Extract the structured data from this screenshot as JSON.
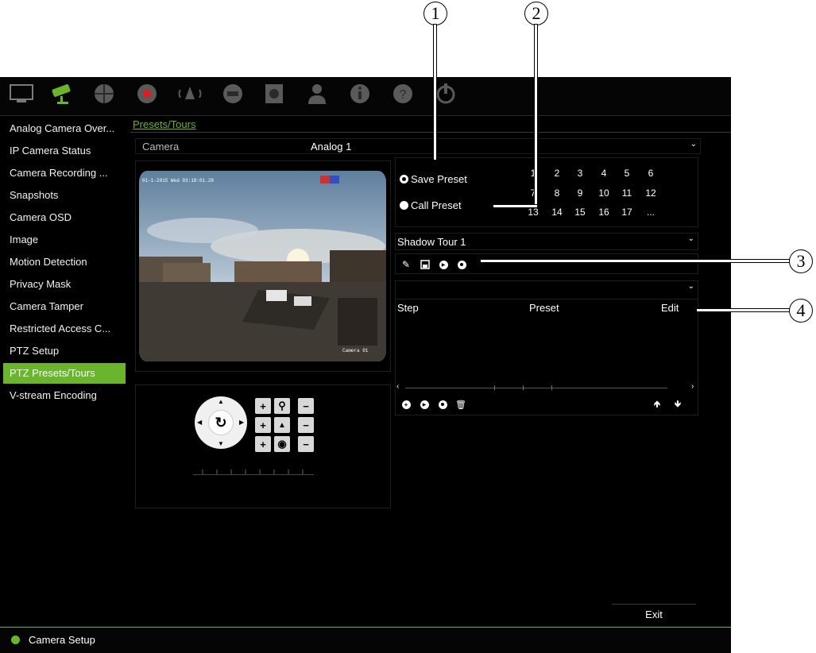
{
  "callouts": [
    "1",
    "2",
    "3",
    "4"
  ],
  "top_icons": [
    "monitor-icon",
    "camera-icon",
    "network-icon",
    "record-icon",
    "alarm-icon",
    "device-icon",
    "storage-icon",
    "user-icon",
    "system-icon",
    "help-icon",
    "power-icon"
  ],
  "sidebar": {
    "items": [
      {
        "label": "Analog Camera Over..."
      },
      {
        "label": "IP Camera Status"
      },
      {
        "label": "Camera Recording ..."
      },
      {
        "label": "Snapshots"
      },
      {
        "label": "Camera OSD"
      },
      {
        "label": "Image"
      },
      {
        "label": "Motion Detection"
      },
      {
        "label": "Privacy Mask"
      },
      {
        "label": "Camera Tamper"
      },
      {
        "label": "Restricted Access C..."
      },
      {
        "label": "PTZ Setup"
      },
      {
        "label": "PTZ Presets/Tours"
      },
      {
        "label": "V-stream Encoding"
      }
    ],
    "active_index": 11
  },
  "breadcrumb": "Presets/Tours",
  "camera": {
    "label": "Camera",
    "value": "Analog 1"
  },
  "video": {
    "timestamp": "01-1-2015 Wed 03:18:01.28",
    "osd_name": "Camera 01"
  },
  "presets": {
    "save_label": "Save Preset",
    "call_label": "Call Preset",
    "numbers": [
      "1",
      "2",
      "3",
      "4",
      "5",
      "6",
      "7",
      "8",
      "9",
      "10",
      "11",
      "12",
      "13",
      "14",
      "15",
      "16",
      "17",
      "..."
    ]
  },
  "tour": {
    "selected": "Shadow Tour 1"
  },
  "table": {
    "headers": {
      "step": "Step",
      "preset": "Preset",
      "edit": "Edit"
    }
  },
  "ptz": {
    "center_symbol": "↻",
    "plus": "+",
    "minus": "−"
  },
  "footer": {
    "status": "Camera Setup",
    "exit_label": "Exit"
  }
}
